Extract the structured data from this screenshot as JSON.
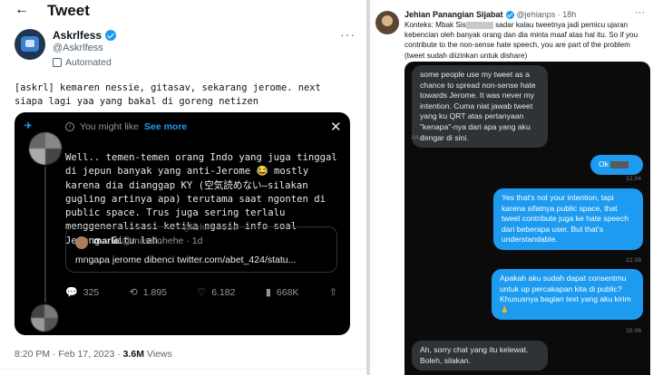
{
  "left": {
    "topbar": {
      "back_icon": "arrow-left-icon",
      "title": "Tweet"
    },
    "author": {
      "name": "Askrlfess",
      "handle": "@Askrlfess",
      "automated_label": "Automated"
    },
    "tweet_text": "[askrl] kemaren nessie, gitasav, sekarang jerome. next siapa lagi yaa yang bakal di goreng netizen",
    "card": {
      "header_label": "You might like",
      "see_more": "See more",
      "body": "Well.. temen-temen orang Indo yang juga tinggal di jepun banyak yang anti-Jerome 😂 mostly karena dia dianggap KY (空気読めない—silakan gugling artinya apa) terutama saat ngonten di public space. Trus juga sering terlalu menggeneralisasi ketika ngasih info soal Jepang. Gitu lah.",
      "watermark": "@Askrlfess",
      "quote": {
        "name": "marlo",
        "handle": "@masalohehe",
        "time": "· 1d",
        "text": "mngapa jerome dibenci twitter.com/abet_424/statu..."
      },
      "actions": {
        "replies": "325",
        "retweets": "1.895",
        "likes": "6.182",
        "views": "668K"
      }
    },
    "meta": {
      "time": "8:20 PM · Feb 17, 2023 · ",
      "views_count": "3.6M",
      "views_label": " Views"
    }
  },
  "right": {
    "author": {
      "name": "Jehian Panangian Sijabat",
      "handle": "@jehianps · 18h"
    },
    "text_pre": "Konteks: Mbak Sis",
    "text_post": " sadar kalau tweetnya jadi pemicu ujaran kebencian oleh banyak orang dan dia minta maaf atas hal itu. So if you contribute to the non-sense hate speech, you are part of the problem (tweet sudah diizinkan untuk dishare)",
    "chat": {
      "m1": "some people use my tweet as a chance to spread non-sense hate towards Jerome. It was never my intention. Cuma niat jawab tweet yang ku QRT atas pertanyaan \"kenapa\"-nya dari apa yang aku dengar di sini.",
      "t1": "04.11",
      "m2": "Ok ",
      "t2": "12.04",
      "m3": "Yes that's not your intention, tapi karena sifatnya public space, that tweet contribute juga ke hate speech dari beberapa user. But that's understandable.",
      "t3": "12.08",
      "m4": "Apakah aku sudah dapat consentmu untuk up percakapan kita di public? Khususnya bagian text yang aku kirim 🙏",
      "t4": "15.06",
      "m5": "Ah, sorry chat yang itu kelewat. Boleh, silakan."
    }
  }
}
